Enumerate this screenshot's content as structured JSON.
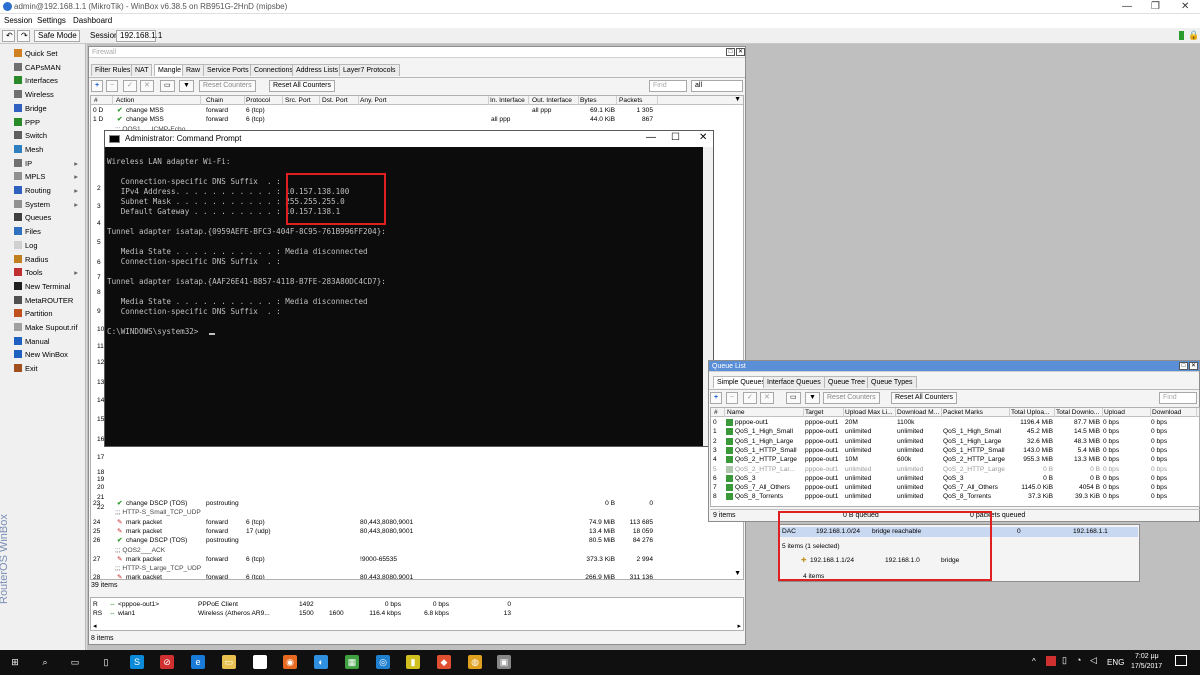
{
  "window": {
    "title": "admin@192.168.1.1 (MikroTik) - WinBox v6.38.5 on RB951G-2HnD (mipsbe)"
  },
  "menu": [
    "Session",
    "Settings",
    "Dashboard"
  ],
  "toolbar": {
    "safe_mode": "Safe Mode",
    "session_label": "Session:",
    "session_value": "192.168.1.1"
  },
  "sidebar": {
    "vertical_text": "RouterOS WinBox",
    "items": [
      {
        "label": "Quick Set",
        "icon": "quickset-icon",
        "color": "#d08020",
        "sub": false
      },
      {
        "label": "CAPsMAN",
        "icon": "capsman-icon",
        "color": "#707070",
        "sub": false
      },
      {
        "label": "Interfaces",
        "icon": "interfaces-icon",
        "color": "#2a8a2a",
        "sub": false
      },
      {
        "label": "Wireless",
        "icon": "wireless-icon",
        "color": "#707070",
        "sub": false
      },
      {
        "label": "Bridge",
        "icon": "bridge-icon",
        "color": "#3060c0",
        "sub": false
      },
      {
        "label": "PPP",
        "icon": "ppp-icon",
        "color": "#2a8a2a",
        "sub": false
      },
      {
        "label": "Switch",
        "icon": "switch-icon",
        "color": "#606060",
        "sub": false
      },
      {
        "label": "Mesh",
        "icon": "mesh-icon",
        "color": "#3080c0",
        "sub": false
      },
      {
        "label": "IP",
        "icon": "ip-icon",
        "color": "#707070",
        "sub": true
      },
      {
        "label": "MPLS",
        "icon": "mpls-icon",
        "color": "#909090",
        "sub": true
      },
      {
        "label": "Routing",
        "icon": "routing-icon",
        "color": "#3060c0",
        "sub": true
      },
      {
        "label": "System",
        "icon": "system-icon",
        "color": "#909090",
        "sub": true
      },
      {
        "label": "Queues",
        "icon": "queues-icon",
        "color": "#404040",
        "sub": false
      },
      {
        "label": "Files",
        "icon": "files-icon",
        "color": "#3070c0",
        "sub": false
      },
      {
        "label": "Log",
        "icon": "log-icon",
        "color": "#d0d0d0",
        "sub": false
      },
      {
        "label": "Radius",
        "icon": "radius-icon",
        "color": "#c08020",
        "sub": false
      },
      {
        "label": "Tools",
        "icon": "tools-icon",
        "color": "#c03030",
        "sub": true
      },
      {
        "label": "New Terminal",
        "icon": "terminal-icon",
        "color": "#202020",
        "sub": false
      },
      {
        "label": "MetaROUTER",
        "icon": "metarouter-icon",
        "color": "#505050",
        "sub": false
      },
      {
        "label": "Partition",
        "icon": "partition-icon",
        "color": "#c05020",
        "sub": false
      },
      {
        "label": "Make Supout.rif",
        "icon": "supout-icon",
        "color": "#a0a0a0",
        "sub": false
      },
      {
        "label": "Manual",
        "icon": "manual-icon",
        "color": "#2060c0",
        "sub": false
      },
      {
        "label": "New WinBox",
        "icon": "winbox-icon",
        "color": "#2060c0",
        "sub": false
      },
      {
        "label": "Exit",
        "icon": "exit-icon",
        "color": "#a05020",
        "sub": false
      }
    ]
  },
  "firewall": {
    "title": "Firewall",
    "tabs": [
      "Filter Rules",
      "NAT",
      "Mangle",
      "Raw",
      "Service Ports",
      "Connections",
      "Address Lists",
      "Layer7 Protocols"
    ],
    "reset_counters": "Reset Counters",
    "reset_all": "Reset All Counters",
    "find": "Find",
    "filter_value": "all",
    "columns": [
      "#",
      "Action",
      "Chain",
      "Protocol",
      "Src. Port",
      "Dst. Port",
      "Any. Port",
      "In. Interface",
      "Out. Interface",
      "Bytes",
      "Packets"
    ],
    "top_rows": [
      {
        "num": "0 D",
        "action": "change MSS",
        "chain": "forward",
        "proto": "6 (tcp)",
        "any": "",
        "in": "",
        "out": "all ppp",
        "bytes": "69.1 KiB",
        "packets": "1 305"
      },
      {
        "num": "1 D",
        "action": "change MSS",
        "chain": "forward",
        "proto": "6 (tcp)",
        "any": "",
        "in": "all ppp",
        "out": "",
        "bytes": "44.0 KiB",
        "packets": "867"
      }
    ],
    "comment_qos1": ";;; QOS1___ICMP-Echo",
    "left_nums": [
      "2",
      "3",
      "4",
      "5",
      "6",
      "7",
      "8",
      "9",
      "10",
      "11",
      "12",
      "13",
      "14",
      "15",
      "16",
      "17",
      "18",
      "19",
      "20",
      "21",
      "22"
    ],
    "bottom_rows": [
      {
        "type": "row",
        "num": "23",
        "action": "change DSCP (TOS)",
        "icon": "check",
        "chain": "postrouting",
        "proto": "",
        "any": "",
        "bytes": "0 B",
        "packets": "0"
      },
      {
        "type": "comment",
        "text": ";;; HTTP-S_Small_TCP_UDP"
      },
      {
        "type": "row",
        "num": "24",
        "action": "mark packet",
        "icon": "pen",
        "chain": "forward",
        "proto": "6 (tcp)",
        "any": "80,443,8080,9001",
        "bytes": "74.9 MiB",
        "packets": "113 685"
      },
      {
        "type": "row",
        "num": "25",
        "action": "mark packet",
        "icon": "pen",
        "chain": "forward",
        "proto": "17 (udp)",
        "any": "80,443,8080,9001",
        "bytes": "13.4 MiB",
        "packets": "18 059"
      },
      {
        "type": "row",
        "num": "26",
        "action": "change DSCP (TOS)",
        "icon": "check",
        "chain": "postrouting",
        "proto": "",
        "any": "",
        "bytes": "80.5 MiB",
        "packets": "84 276"
      },
      {
        "type": "comment",
        "text": ";;; QOS2___ACK"
      },
      {
        "type": "row",
        "num": "27",
        "action": "mark packet",
        "icon": "pen",
        "chain": "forward",
        "proto": "6 (tcp)",
        "any": "!9000-65535",
        "bytes": "373.3 KiB",
        "packets": "2 994"
      },
      {
        "type": "comment",
        "text": ";;; HTTP-S_Large_TCP_UDP"
      },
      {
        "type": "row",
        "num": "28",
        "action": "mark packet",
        "icon": "pen",
        "chain": "forward",
        "proto": "6 (tcp)",
        "any": "80,443,8080,9001",
        "bytes": "266.9 MiB",
        "packets": "311 136"
      },
      {
        "type": "row",
        "num": "29",
        "action": "mark packet",
        "icon": "pen",
        "chain": "forward",
        "proto": "17 (udp)",
        "any": "80,443,8080,9001",
        "bytes": "53.8 MiB",
        "packets": "61 066"
      },
      {
        "type": "row",
        "num": "30",
        "action": "change DSCP (TOS)",
        "icon": "check",
        "chain": "postrouting",
        "proto": "",
        "any": "",
        "bytes": "0 B",
        "packets": "0"
      },
      {
        "type": "comment",
        "text": ";;; QOS3___FTP_SSH_Telnet_SMTP_POP3-S_SNTP_IMAP-S_SMTP-S"
      },
      {
        "type": "row",
        "num": "31",
        "action": "mark packet",
        "icon": "pen",
        "chain": "forward",
        "proto": "6 (tcp)",
        "any": "20,21,22,23,25,110,143,465,587,993,995",
        "bytes": "0 B",
        "packets": "0"
      },
      {
        "type": "row",
        "num": "32",
        "action": "change DSCP (TOS)",
        "icon": "check",
        "chain": "postrouting",
        "proto": "",
        "any": "",
        "bytes": "0 B",
        "packets": "0"
      }
    ],
    "status": "39 items"
  },
  "interfaces_panel": {
    "rows": [
      {
        "flag": "R",
        "name": "<pppoe-out1>",
        "type": "PPPoE Client",
        "mtu": "1492",
        "l2mtu": "",
        "tx": "0 bps",
        "rx": "0 bps",
        "a": "0",
        "b": ""
      },
      {
        "flag": "RS",
        "name": "wlan1",
        "type": "Wireless (Atheros AR9...",
        "mtu": "1500",
        "l2mtu": "1600",
        "tx": "116.4 kbps",
        "rx": "6.8 kbps",
        "a": "13",
        "b": ""
      }
    ],
    "status": "8 items"
  },
  "cmd": {
    "title": "Administrator: Command Prompt",
    "lines": [
      "Wireless LAN adapter Wi-Fi:",
      "",
      "   Connection-specific DNS Suffix  . :",
      "   IPv4 Address. . . . . . . . . . . : 10.157.138.100",
      "   Subnet Mask . . . . . . . . . . . : 255.255.255.0",
      "   Default Gateway . . . . . . . . . : 10.157.138.1",
      "",
      "Tunnel adapter isatap.{0959AEFE-BFC3-404F-8C95-761B996FF204}:",
      "",
      "   Media State . . . . . . . . . . . : Media disconnected",
      "   Connection-specific DNS Suffix  . :",
      "",
      "Tunnel adapter isatap.{AAF26E41-B857-4118-B7FE-283A80DC4CD7}:",
      "",
      "   Media State . . . . . . . . . . . : Media disconnected",
      "   Connection-specific DNS Suffix  . :",
      "",
      "C:\\WINDOWS\\system32>"
    ]
  },
  "queue": {
    "title": "Queue List",
    "tabs": [
      "Simple Queues",
      "Interface Queues",
      "Queue Tree",
      "Queue Types"
    ],
    "reset_counters": "Reset Counters",
    "reset_all": "Reset All Counters",
    "find": "Find",
    "columns": [
      "#",
      "Name",
      "Target",
      "Upload Max Li...",
      "Download M...",
      "Packet Marks",
      "Total Uploa...",
      "Total Downlo...",
      "Upload",
      "Download"
    ],
    "rows": [
      {
        "num": "0",
        "name": "pppoe-out1",
        "target": "pppoe-out1",
        "up": "20M",
        "down": "1100k",
        "marks": "",
        "tu": "1196.4 MiB",
        "td": "87.7 MiB",
        "u": "0 bps",
        "d": "0 bps",
        "dis": false
      },
      {
        "num": "1",
        "name": "QoS_1_High_Small",
        "target": "pppoe-out1",
        "up": "unlimited",
        "down": "unlimited",
        "marks": "QoS_1_High_Small",
        "tu": "45.2 MiB",
        "td": "14.5 MiB",
        "u": "0 bps",
        "d": "0 bps",
        "dis": false
      },
      {
        "num": "2",
        "name": "QoS_1_High_Large",
        "target": "pppoe-out1",
        "up": "unlimited",
        "down": "unlimited",
        "marks": "QoS_1_High_Large",
        "tu": "32.6 MiB",
        "td": "48.3 MiB",
        "u": "0 bps",
        "d": "0 bps",
        "dis": false
      },
      {
        "num": "3",
        "name": "QoS_1_HTTP_Small",
        "target": "pppoe-out1",
        "up": "unlimited",
        "down": "unlimited",
        "marks": "QoS_1_HTTP_Small",
        "tu": "143.0 MiB",
        "td": "5.4 MiB",
        "u": "0 bps",
        "d": "0 bps",
        "dis": false
      },
      {
        "num": "4",
        "name": "QoS_2_HTTP_Large",
        "target": "pppoe-out1",
        "up": "10M",
        "down": "600k",
        "marks": "QoS_2_HTTP_Large",
        "tu": "955.3 MiB",
        "td": "13.3 MiB",
        "u": "0 bps",
        "d": "0 bps",
        "dis": false
      },
      {
        "num": "5",
        "name": "QoS_2_HTTP_Lar...",
        "target": "pppoe-out1",
        "up": "unlimited",
        "down": "unlimited",
        "marks": "QoS_2_HTTP_Large",
        "tu": "0 B",
        "td": "0 B",
        "u": "0 bps",
        "d": "0 bps",
        "dis": true
      },
      {
        "num": "6",
        "name": "QoS_3",
        "target": "pppoe-out1",
        "up": "unlimited",
        "down": "unlimited",
        "marks": "QoS_3",
        "tu": "0 B",
        "td": "0 B",
        "u": "0 bps",
        "d": "0 bps",
        "dis": false
      },
      {
        "num": "7",
        "name": "QoS_7_All_Others",
        "target": "pppoe-out1",
        "up": "unlimited",
        "down": "unlimited",
        "marks": "QoS_7_All_Others",
        "tu": "1145.0 KiB",
        "td": "4054 B",
        "u": "0 bps",
        "d": "0 bps",
        "dis": false
      },
      {
        "num": "8",
        "name": "QoS_8_Torrents",
        "target": "pppoe-out1",
        "up": "unlimited",
        "down": "unlimited",
        "marks": "QoS_8_Torrents",
        "tu": "37.3 KiB",
        "td": "39.3 KiB",
        "u": "0 bps",
        "d": "0 bps",
        "dis": false
      }
    ],
    "status_items": "9 items",
    "status_queued": "0 B queued",
    "status_packets": "0 packets queued"
  },
  "lease": {
    "row": {
      "flag": "DAC",
      "address": "192.168.1.0/24",
      "network": "bridge reachable",
      "count": "0",
      "gateway": "192.168.1.1"
    },
    "status": "5 items (1 selected)",
    "addr_row": {
      "address": "192.168.1.1/24",
      "network": "192.168.1.0",
      "iface": "bridge"
    },
    "addr_status": "4 items"
  },
  "taskbar": {
    "lang": "ENG",
    "time": "7:02 μμ",
    "date": "17/5/2017",
    "apps": [
      {
        "icon": "start-icon",
        "color": "#ffffff"
      },
      {
        "icon": "search-icon",
        "color": "#ffffff"
      },
      {
        "icon": "taskview-icon",
        "color": "#ffffff"
      },
      {
        "icon": "document-icon",
        "color": "#ffffff"
      },
      {
        "icon": "skype-icon",
        "color": "#0a8ad8"
      },
      {
        "icon": "blocked-icon",
        "color": "#d03030"
      },
      {
        "icon": "edge-icon",
        "color": "#1a7ad8"
      },
      {
        "icon": "folder-icon",
        "color": "#e8c050"
      },
      {
        "icon": "app-icon",
        "color": "#ffffff"
      },
      {
        "icon": "firefox-icon",
        "color": "#e86a20"
      },
      {
        "icon": "app2-icon",
        "color": "#3090e0"
      },
      {
        "icon": "app3-icon",
        "color": "#40a040"
      },
      {
        "icon": "app4-icon",
        "color": "#2080d0"
      },
      {
        "icon": "app5-icon",
        "color": "#d0c020"
      },
      {
        "icon": "app6-icon",
        "color": "#e05030"
      },
      {
        "icon": "chrome-icon",
        "color": "#e0a020"
      },
      {
        "icon": "cmd-icon",
        "color": "#888888"
      }
    ]
  }
}
